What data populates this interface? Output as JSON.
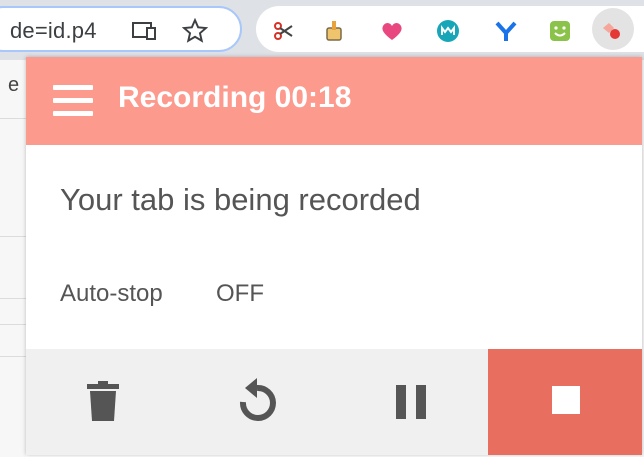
{
  "browser": {
    "url_fragment": "de=id.p4",
    "omnibox_icons": [
      "cast-icon",
      "star-icon"
    ],
    "extensions": [
      "scissors-icon",
      "bucket-icon",
      "heart-icon",
      "m-circle-icon",
      "y-icon",
      "smiley-icon",
      "screen-recorder-icon"
    ]
  },
  "page_sliver": {
    "letter": "e"
  },
  "popup": {
    "title": "Recording 00:18",
    "status": "Your tab is being recorded",
    "autostop_label": "Auto-stop",
    "autostop_value": "OFF",
    "controls": [
      "delete-icon",
      "restart-icon",
      "pause-icon",
      "stop-icon"
    ]
  },
  "colors": {
    "header": "#fd9a8e",
    "stop_button": "#e86f60",
    "controls_bg": "#f0f0f0",
    "text": "#555555"
  }
}
